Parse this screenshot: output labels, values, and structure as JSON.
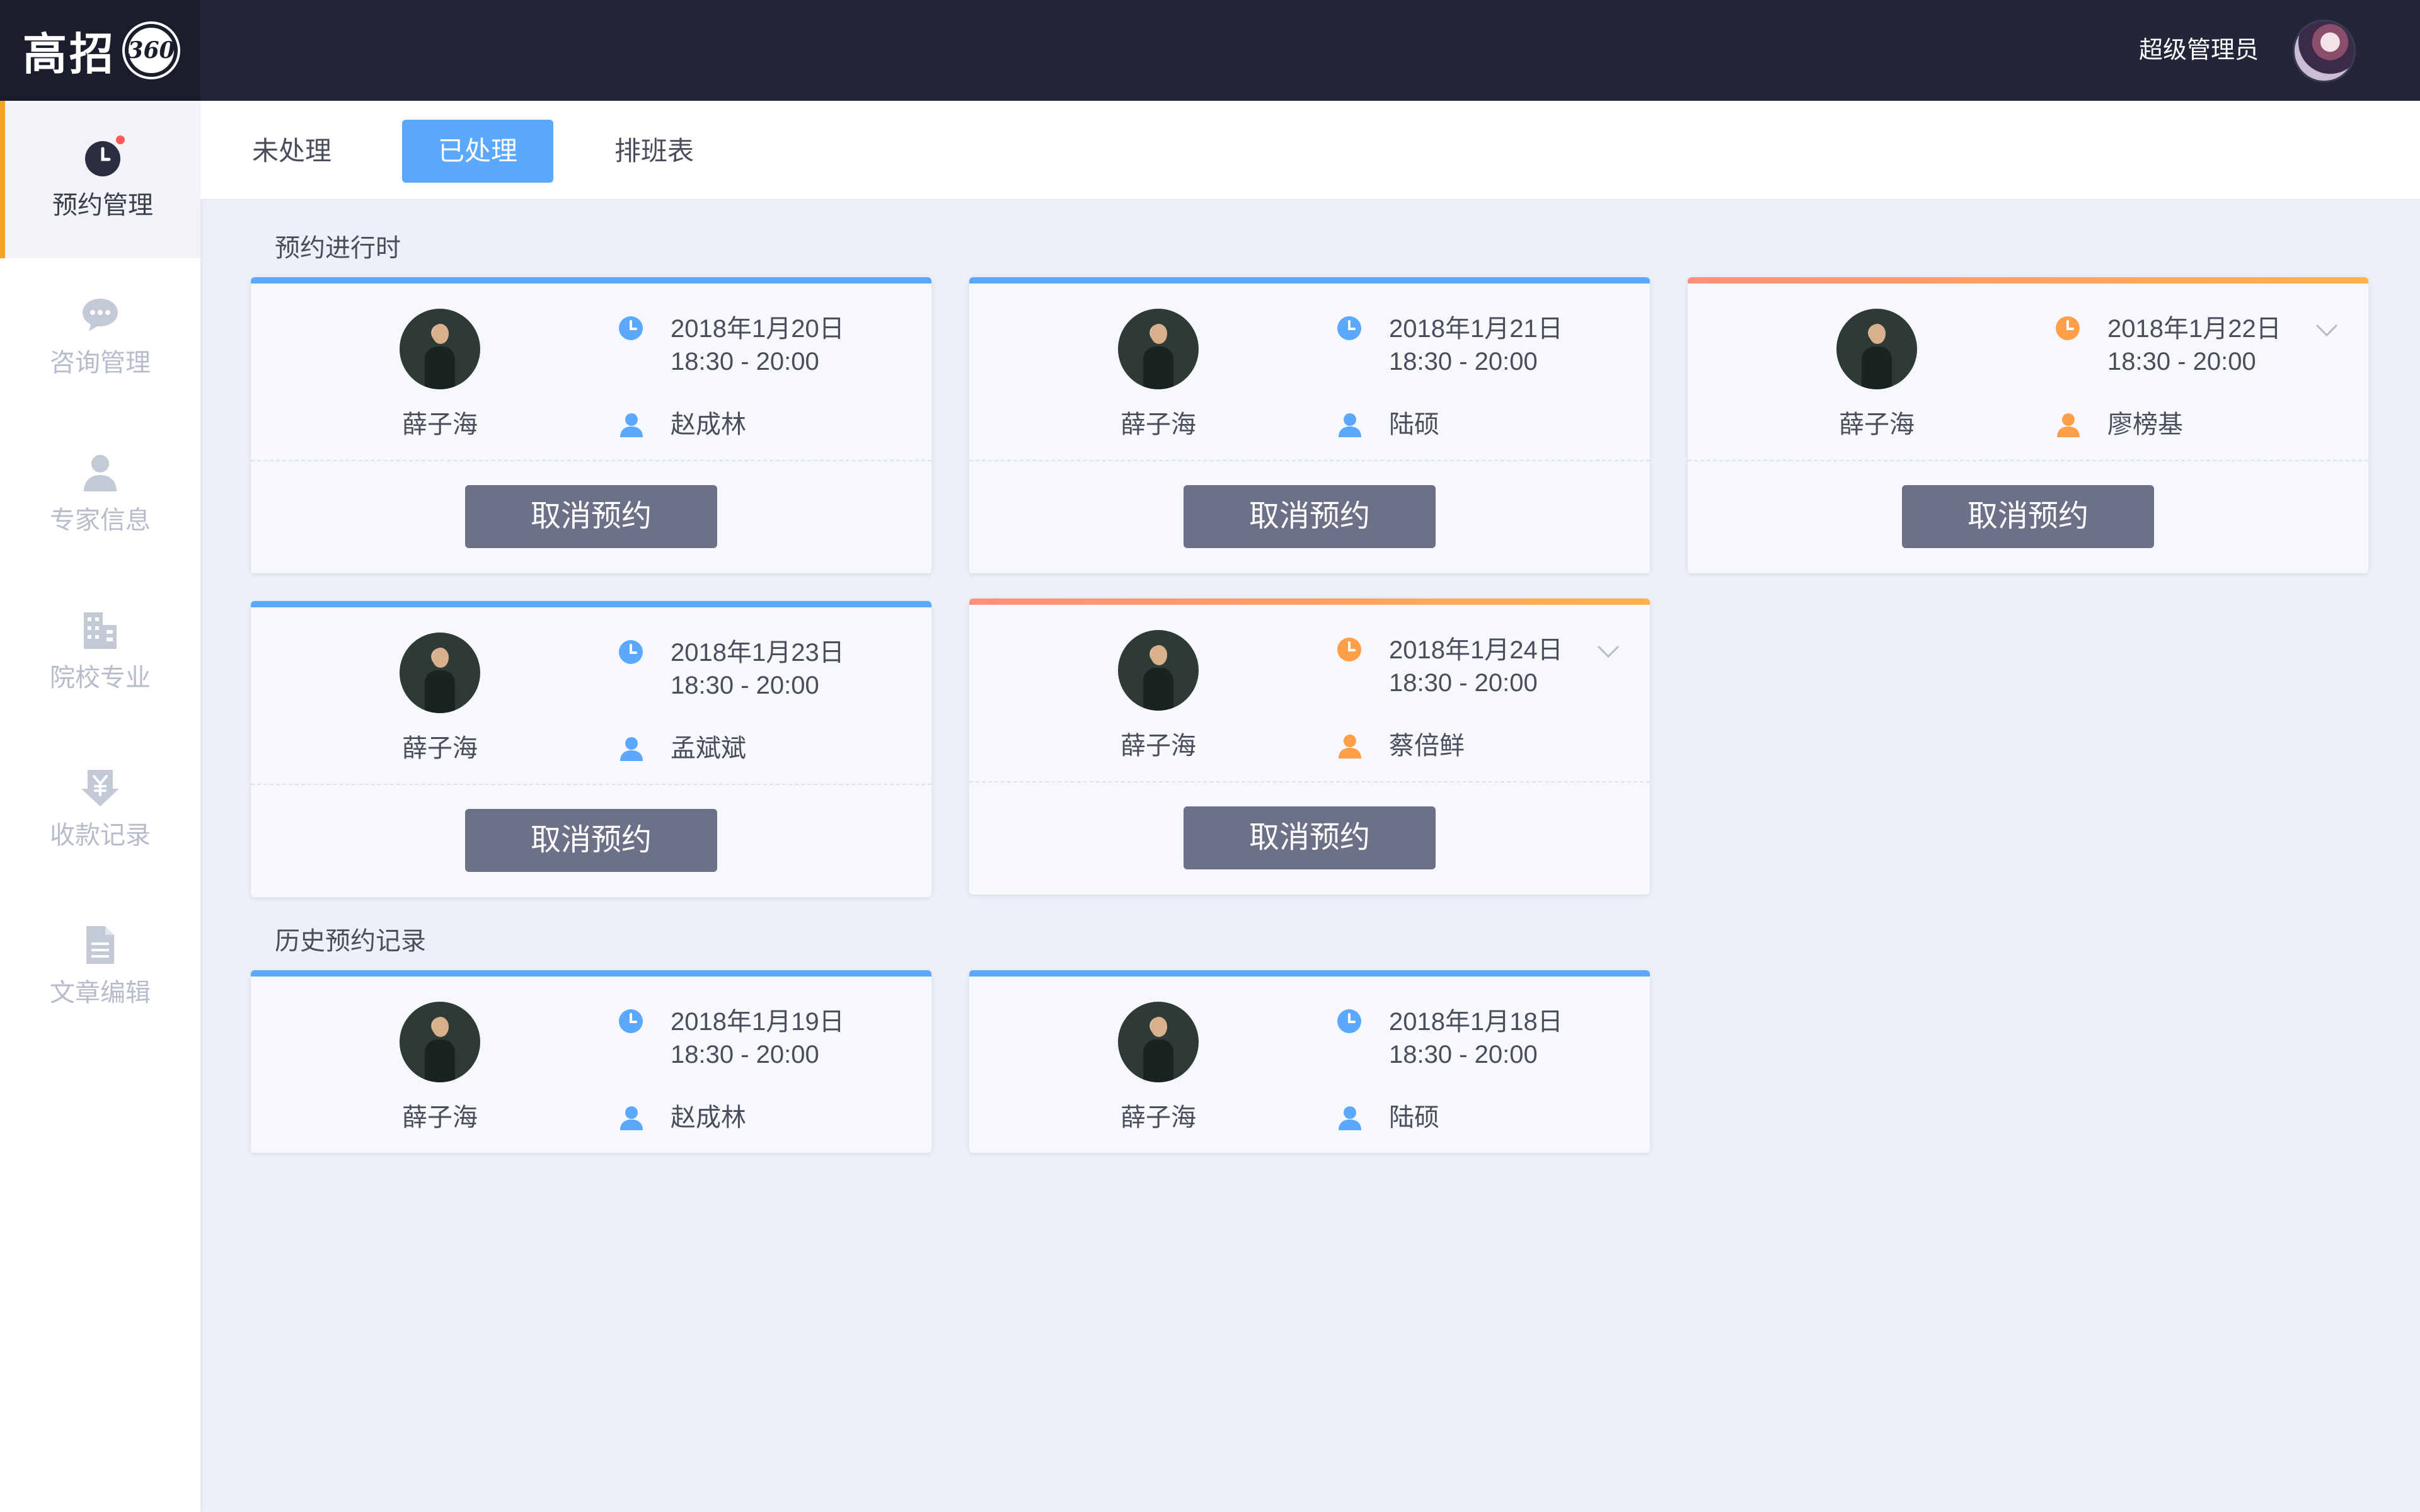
{
  "app": {
    "logo_text": "高招",
    "logo_badge": "360",
    "user_name": "超级管理员"
  },
  "sidebar": {
    "items": [
      {
        "label": "预约管理",
        "icon": "clock-icon",
        "active": true,
        "has_badge": true
      },
      {
        "label": "咨询管理",
        "icon": "chat-icon",
        "active": false
      },
      {
        "label": "专家信息",
        "icon": "person-icon",
        "active": false
      },
      {
        "label": "院校专业",
        "icon": "building-icon",
        "active": false
      },
      {
        "label": "收款记录",
        "icon": "yen-download-icon",
        "active": false
      },
      {
        "label": "文章编辑",
        "icon": "document-icon",
        "active": false
      }
    ]
  },
  "tabs": [
    {
      "label": "未处理",
      "active": false
    },
    {
      "label": "已处理",
      "active": true
    },
    {
      "label": "排班表",
      "active": false
    }
  ],
  "sections": {
    "ongoing_title": "预约进行时",
    "history_title": "历史预约记录"
  },
  "cards": [
    {
      "expert": "薛子海",
      "date": "2018年1月20日",
      "time": "18:30 - 20:00",
      "student": "赵成林",
      "status": "processed",
      "button": "取消预约"
    },
    {
      "expert": "薛子海",
      "date": "2018年1月21日",
      "time": "18:30 - 20:00",
      "student": "陆硕",
      "status": "processed",
      "button": "取消预约"
    },
    {
      "expert": "薛子海",
      "date": "2018年1月22日",
      "time": "18:30 - 20:00",
      "student": "廖榜基",
      "status": "pending",
      "button": "取消预约"
    },
    {
      "expert": "薛子海",
      "date": "2018年1月23日",
      "time": "18:30 - 20:00",
      "student": "孟斌斌",
      "status": "processed",
      "button": "取消预约"
    },
    {
      "expert": "薛子海",
      "date": "2018年1月24日",
      "time": "18:30 - 20:00",
      "student": "蔡倍鲜",
      "status": "pending",
      "button": "取消预约"
    }
  ],
  "history": [
    {
      "expert": "薛子海",
      "date": "2018年1月19日",
      "time": "18:30 - 20:00",
      "student": "赵成林"
    },
    {
      "expert": "薛子海",
      "date": "2018年1月18日",
      "time": "18:30 - 20:00",
      "student": "陆硕"
    }
  ],
  "colors": {
    "topbar": "#232639",
    "accent_blue": "#5aa9ff",
    "accent_orange": "#ff9f4a",
    "button_gray": "#6c7188",
    "active_marker": "#f5a524"
  }
}
